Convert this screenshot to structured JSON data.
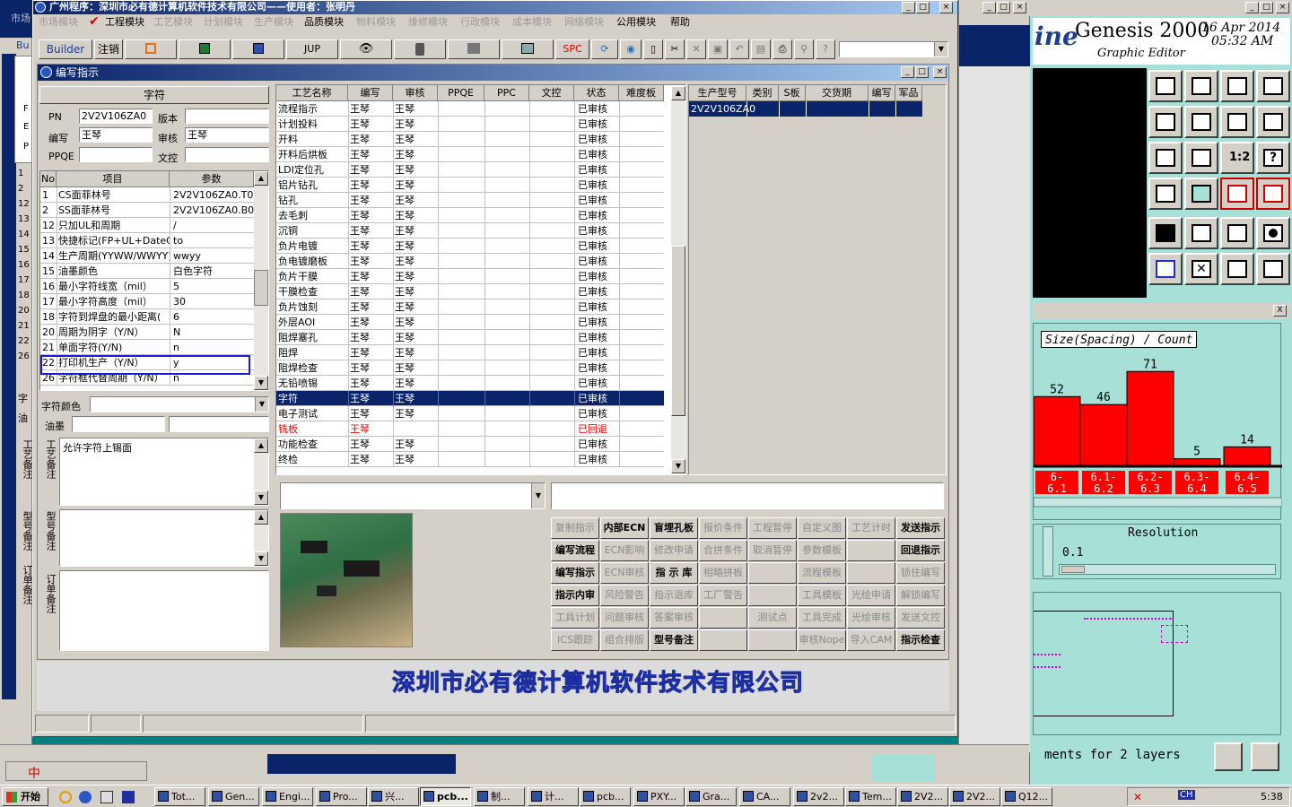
{
  "app_window": {
    "title": "广州程序：深圳市必有德计算机软件技术有限公司——使用者：张明丹",
    "menu": [
      "市场模块",
      "工程模块",
      "工艺模块",
      "计划模块",
      "生产模块",
      "品质模块",
      "物料模块",
      "维修模块",
      "行政模块",
      "成本模块",
      "网络模块",
      "公用模块",
      "帮助"
    ],
    "menu_enabled": [
      false,
      true,
      false,
      false,
      false,
      true,
      false,
      false,
      false,
      false,
      false,
      true,
      true
    ],
    "toolbar_labels": {
      "builder": "Builder",
      "cancel": "注销",
      "jup": "JUP",
      "spc": "SPC"
    },
    "footer_company": "深圳市必有德计算机软件技术有限公司"
  },
  "dialog": {
    "title": "编写指示",
    "char_group_label": "字符",
    "fields": {
      "pn_label": "PN",
      "pn_value": "2V2V106ZA0",
      "version_label": "版本",
      "version_value": "",
      "writer_label": "编写",
      "writer_value": "王琴",
      "reviewer_label": "审核",
      "reviewer_value": "王琴",
      "ppqe_label": "PPQE",
      "ppqe_value": "",
      "doc_label": "文控",
      "doc_value": ""
    },
    "item_table": {
      "headers": [
        "No",
        "项目",
        "参数"
      ],
      "rows": [
        {
          "no": "1",
          "item": "CS面菲林号",
          "param": "2V2V106ZA0.T0"
        },
        {
          "no": "2",
          "item": "SS面菲林号",
          "param": "2V2V106ZA0.B0"
        },
        {
          "no": "12",
          "item": "只加UL和周期",
          "param": "/"
        },
        {
          "no": "13",
          "item": "快捷标记(FP+UL+DateCo",
          "param": "to"
        },
        {
          "no": "14",
          "item": "生产周期(YYWW/WWYY)",
          "param": "wwyy"
        },
        {
          "no": "15",
          "item": "油墨颜色",
          "param": "白色字符"
        },
        {
          "no": "16",
          "item": "最小字符线宽（mil）",
          "param": "5"
        },
        {
          "no": "17",
          "item": "最小字符高度（mil）",
          "param": "30"
        },
        {
          "no": "18",
          "item": "字符到焊盘的最小距离(",
          "param": "6"
        },
        {
          "no": "20",
          "item": "周期为阴字（Y/N）",
          "param": "N"
        },
        {
          "no": "21",
          "item": "单面字符(Y/N)",
          "param": "n"
        },
        {
          "no": "22",
          "item": "打印机生产（Y/N）",
          "param": "y"
        },
        {
          "no": "26",
          "item": "字符框代替周期（Y/N）",
          "param": "n"
        }
      ],
      "left_strip_numbers": [
        "1",
        "2",
        "12",
        "13",
        "14",
        "15",
        "16",
        "17",
        "18",
        "20",
        "21",
        "22",
        "26"
      ]
    },
    "char_color_label": "字符颜色",
    "ink_label": "油墨",
    "process_note_label": "工艺备注",
    "process_note_value": "允许字符上锡面",
    "model_note_label": "型号备注",
    "order_note_label": "订单备注",
    "process_table": {
      "headers": [
        "工艺名称",
        "编写",
        "审核",
        "PPQE",
        "PPC",
        "文控",
        "状态",
        "难度板"
      ],
      "rows": [
        {
          "name": "流程指示",
          "writer": "王琴",
          "reviewer": "王琴",
          "status": "已审核",
          "red": false
        },
        {
          "name": "计划投料",
          "writer": "王琴",
          "reviewer": "王琴",
          "status": "已审核",
          "red": false
        },
        {
          "name": "开料",
          "writer": "王琴",
          "reviewer": "王琴",
          "status": "已审核",
          "red": false
        },
        {
          "name": "开料后烘板",
          "writer": "王琴",
          "reviewer": "王琴",
          "status": "已审核",
          "red": false
        },
        {
          "name": "LDI定位孔",
          "writer": "王琴",
          "reviewer": "王琴",
          "status": "已审核",
          "red": false
        },
        {
          "name": "铝片钻孔",
          "writer": "王琴",
          "reviewer": "王琴",
          "status": "已审核",
          "red": false
        },
        {
          "name": "钻孔",
          "writer": "王琴",
          "reviewer": "王琴",
          "status": "已审核",
          "red": false
        },
        {
          "name": "去毛刺",
          "writer": "王琴",
          "reviewer": "王琴",
          "status": "已审核",
          "red": false
        },
        {
          "name": "沉铜",
          "writer": "王琴",
          "reviewer": "王琴",
          "status": "已审核",
          "red": false
        },
        {
          "name": "负片电镀",
          "writer": "王琴",
          "reviewer": "王琴",
          "status": "已审核",
          "red": false
        },
        {
          "name": "负电镀磨板",
          "writer": "王琴",
          "reviewer": "王琴",
          "status": "已审核",
          "red": false
        },
        {
          "name": "负片干膜",
          "writer": "王琴",
          "reviewer": "王琴",
          "status": "已审核",
          "red": false
        },
        {
          "name": "干膜检查",
          "writer": "王琴",
          "reviewer": "王琴",
          "status": "已审核",
          "red": false
        },
        {
          "name": "负片蚀刻",
          "writer": "王琴",
          "reviewer": "王琴",
          "status": "已审核",
          "red": false
        },
        {
          "name": "外层AOI",
          "writer": "王琴",
          "reviewer": "王琴",
          "status": "已审核",
          "red": false
        },
        {
          "name": "阻焊塞孔",
          "writer": "王琴",
          "reviewer": "王琴",
          "status": "已审核",
          "red": false
        },
        {
          "name": "阻焊",
          "writer": "王琴",
          "reviewer": "王琴",
          "status": "已审核",
          "red": false
        },
        {
          "name": "阻焊检查",
          "writer": "王琴",
          "reviewer": "王琴",
          "status": "已审核",
          "red": false
        },
        {
          "name": "无铅喷锡",
          "writer": "王琴",
          "reviewer": "王琴",
          "status": "已审核",
          "red": false
        },
        {
          "name": "字符",
          "writer": "王琴",
          "reviewer": "王琴",
          "status": "已审核",
          "red": false
        },
        {
          "name": "电子测试",
          "writer": "王琴",
          "reviewer": "王琴",
          "status": "已审核",
          "red": false
        },
        {
          "name": "铣板",
          "writer": "王琴",
          "reviewer": "",
          "status": "已回退",
          "red": true
        },
        {
          "name": "功能检查",
          "writer": "王琴",
          "reviewer": "王琴",
          "status": "已审核",
          "red": false
        },
        {
          "name": "终检",
          "writer": "王琴",
          "reviewer": "王琴",
          "status": "已审核",
          "red": false
        }
      ],
      "selected_index": 19
    },
    "order_table": {
      "headers": [
        "生产型号",
        "类别",
        "S板",
        "交货期",
        "编写",
        "军品"
      ],
      "rows": [
        {
          "model": "2V2V106ZA0",
          "type": "",
          "sboard": "",
          "delivery": "",
          "writer": "",
          "military": ""
        }
      ]
    },
    "action_buttons": [
      {
        "label": "复制指示",
        "enabled": false
      },
      {
        "label": "内部ECN",
        "enabled": true
      },
      {
        "label": "盲埋孔板",
        "enabled": true
      },
      {
        "label": "报价条件",
        "enabled": false
      },
      {
        "label": "工程暂停",
        "enabled": false
      },
      {
        "label": "自定义图",
        "enabled": false
      },
      {
        "label": "工艺计时",
        "enabled": false
      },
      {
        "label": "发送指示",
        "enabled": true
      },
      {
        "label": "编写流程",
        "enabled": true
      },
      {
        "label": "ECN影响",
        "enabled": false
      },
      {
        "label": "修改申请",
        "enabled": false
      },
      {
        "label": "合拼条件",
        "enabled": false
      },
      {
        "label": "取消暂停",
        "enabled": false
      },
      {
        "label": "参数模板",
        "enabled": false
      },
      {
        "label": "",
        "enabled": false
      },
      {
        "label": "回退指示",
        "enabled": true
      },
      {
        "label": "编写指示",
        "enabled": true
      },
      {
        "label": "ECN审核",
        "enabled": false
      },
      {
        "label": "指 示 库",
        "enabled": true
      },
      {
        "label": "相略拼板",
        "enabled": false
      },
      {
        "label": "",
        "enabled": false
      },
      {
        "label": "流程模板",
        "enabled": false
      },
      {
        "label": "",
        "enabled": false
      },
      {
        "label": "锁住编写",
        "enabled": false
      },
      {
        "label": "指示内审",
        "enabled": true
      },
      {
        "label": "风险警告",
        "enabled": false
      },
      {
        "label": "指示退库",
        "enabled": false
      },
      {
        "label": "工厂警告",
        "enabled": false
      },
      {
        "label": "",
        "enabled": false
      },
      {
        "label": "工具模板",
        "enabled": false
      },
      {
        "label": "光绘申请",
        "enabled": false
      },
      {
        "label": "解锁编写",
        "enabled": false
      },
      {
        "label": "工具计划",
        "enabled": false
      },
      {
        "label": "问题审核",
        "enabled": false
      },
      {
        "label": "答案审核",
        "enabled": false
      },
      {
        "label": "",
        "enabled": false
      },
      {
        "label": "测试点",
        "enabled": false
      },
      {
        "label": "工具完成",
        "enabled": false
      },
      {
        "label": "光绘审核",
        "enabled": false
      },
      {
        "label": "发送文控",
        "enabled": false
      },
      {
        "label": "ICS跟踪",
        "enabled": false
      },
      {
        "label": "组合排版",
        "enabled": false
      },
      {
        "label": "型号备注",
        "enabled": true
      },
      {
        "label": "",
        "enabled": false
      },
      {
        "label": "",
        "enabled": false
      },
      {
        "label": "审核Nope",
        "enabled": false
      },
      {
        "label": "导入CAM",
        "enabled": false
      },
      {
        "label": "指示检查",
        "enabled": true
      }
    ]
  },
  "genesis": {
    "logo_fragment": "ine",
    "title": "Genesis 2000",
    "subtitle": "Graphic Editor",
    "date": "16 Apr 2014",
    "time": "05:32 AM",
    "histogram_title": "Size(Spacing) / Count",
    "resolution_label": "Resolution",
    "resolution_value": "0.1",
    "measurement_text": "ments for 2 layers",
    "win_btn_min": "_",
    "win_btn_close": "X"
  },
  "chart_data": {
    "type": "bar",
    "title": "Size(Spacing) / Count",
    "categories": [
      "6.0-6.1",
      "6.1-6.2",
      "6.2-6.3",
      "6.3-6.4",
      "6.4-6.5"
    ],
    "values": [
      52,
      46,
      71,
      5,
      14
    ],
    "tick_labels": [
      [
        "6-",
        "6.1"
      ],
      [
        "6.1-",
        "6.2"
      ],
      [
        "6.2-",
        "6.3"
      ],
      [
        "6.3-",
        "6.4"
      ],
      [
        "6.4-",
        "6.5"
      ]
    ],
    "ylim": [
      0,
      80
    ],
    "bar_color": "#ff0000"
  },
  "behind_strips": {
    "leftmost": [
      "市场",
      "Bu",
      "F",
      "E",
      "P"
    ],
    "left_numbers": [
      "1",
      "2",
      "12",
      "13",
      "14",
      "15",
      "16",
      "17",
      "18",
      "20",
      "21",
      "22",
      "26"
    ],
    "left_labels": [
      "字",
      "油",
      "工艺备注",
      "型号备注",
      "订单备注"
    ]
  },
  "taskbar": {
    "start_label": "开始",
    "ime_label": "中",
    "items": [
      "Tot...",
      "Gen...",
      "Engi...",
      "Pro...",
      "兴...",
      "pcb...",
      "制...",
      "计...",
      "pcb...",
      "PXY...",
      "Gra...",
      "CA...",
      "2v2...",
      "Tem...",
      "2V2...",
      "2V2...",
      "Q12..."
    ],
    "active_index": 5,
    "clock": "5:38",
    "tray_ch": "CH"
  },
  "colors": {
    "window_title_active": "#0a246a",
    "selection": "#0a246a",
    "desktop": "#008080",
    "status_red": "#ff0000",
    "genesis_bg": "#a6e0d6"
  }
}
